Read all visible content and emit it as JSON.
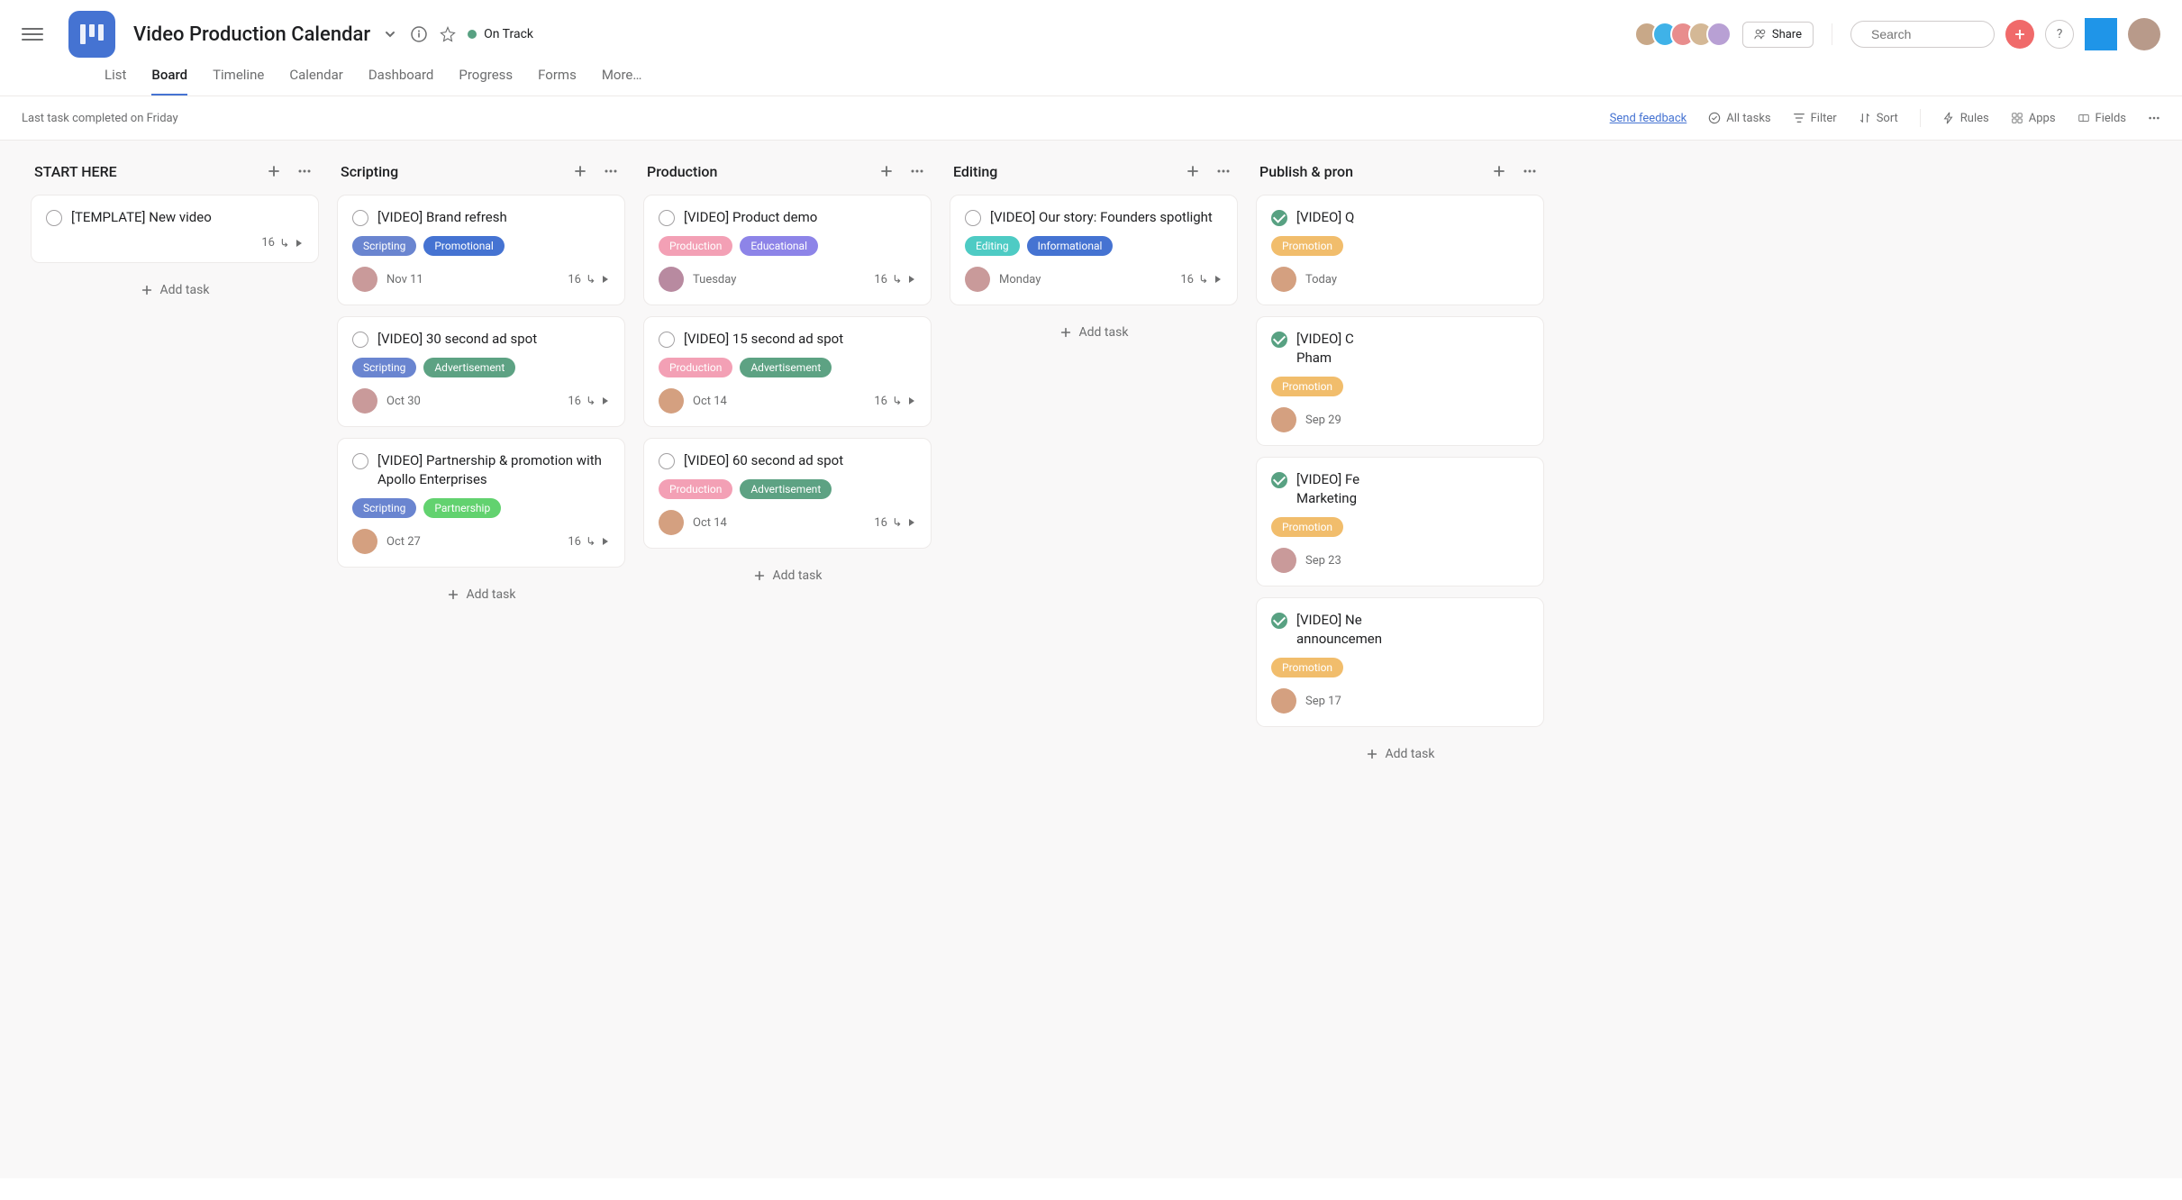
{
  "header": {
    "title": "Video Production Calendar",
    "status": "On Track",
    "tabs": [
      "List",
      "Board",
      "Timeline",
      "Calendar",
      "Dashboard",
      "Progress",
      "Forms",
      "More…"
    ],
    "active_tab": "Board",
    "share_label": "Share",
    "search_placeholder": "Search",
    "avatar_colors": [
      "#c8a888",
      "#3fb2e8",
      "#e88d8d",
      "#d4b896",
      "#b8a0d4"
    ]
  },
  "subheader": {
    "left": "Last task completed on Friday",
    "feedback": "Send feedback",
    "all_tasks": "All tasks",
    "filter": "Filter",
    "sort": "Sort",
    "rules": "Rules",
    "apps": "Apps",
    "fields": "Fields"
  },
  "add_task_label": "Add task",
  "columns": [
    {
      "title": "START HERE",
      "cards": [
        {
          "done": false,
          "title": "[TEMPLATE] New video",
          "tags": [],
          "assignee": null,
          "date": "",
          "subtasks": "16",
          "simple": true
        }
      ]
    },
    {
      "title": "Scripting",
      "cards": [
        {
          "done": false,
          "title": "[VIDEO] Brand refresh",
          "tags": [
            {
              "label": "Scripting",
              "class": "tag-scripting"
            },
            {
              "label": "Promotional",
              "class": "tag-promotional"
            }
          ],
          "assignee": "#c99a9a",
          "date": "Nov 11",
          "subtasks": "16"
        },
        {
          "done": false,
          "title": "[VIDEO] 30 second ad spot",
          "tags": [
            {
              "label": "Scripting",
              "class": "tag-scripting"
            },
            {
              "label": "Advertisement",
              "class": "tag-advertisement"
            }
          ],
          "assignee": "#c99a9a",
          "date": "Oct 30",
          "subtasks": "16"
        },
        {
          "done": false,
          "title": "[VIDEO] Partnership & promotion with Apollo Enterprises",
          "tags": [
            {
              "label": "Scripting",
              "class": "tag-scripting"
            },
            {
              "label": "Partnership",
              "class": "tag-partnership"
            }
          ],
          "assignee": "#d4a080",
          "date": "Oct 27",
          "subtasks": "16"
        }
      ]
    },
    {
      "title": "Production",
      "cards": [
        {
          "done": false,
          "title": "[VIDEO] Product demo",
          "tags": [
            {
              "label": "Production",
              "class": "tag-production"
            },
            {
              "label": "Educational",
              "class": "tag-educational"
            }
          ],
          "assignee": "#b88aa0",
          "date": "Tuesday",
          "subtasks": "16"
        },
        {
          "done": false,
          "title": "[VIDEO] 15 second ad spot",
          "tags": [
            {
              "label": "Production",
              "class": "tag-production"
            },
            {
              "label": "Advertisement",
              "class": "tag-advertisement"
            }
          ],
          "assignee": "#d4a080",
          "date": "Oct 14",
          "subtasks": "16"
        },
        {
          "done": false,
          "title": "[VIDEO] 60 second ad spot",
          "tags": [
            {
              "label": "Production",
              "class": "tag-production"
            },
            {
              "label": "Advertisement",
              "class": "tag-advertisement"
            }
          ],
          "assignee": "#d4a080",
          "date": "Oct 14",
          "subtasks": "16"
        }
      ]
    },
    {
      "title": "Editing",
      "cards": [
        {
          "done": false,
          "title": "[VIDEO] Our story: Founders spotlight",
          "tags": [
            {
              "label": "Editing",
              "class": "tag-editing"
            },
            {
              "label": "Informational",
              "class": "tag-informational"
            }
          ],
          "assignee": "#c99a9a",
          "date": "Monday",
          "subtasks": "16"
        }
      ]
    },
    {
      "title": "Publish & pron",
      "cards": [
        {
          "done": true,
          "title": "[VIDEO] Q",
          "tags": [
            {
              "label": "Promotion",
              "class": "tag-promotion"
            }
          ],
          "assignee": "#d4a080",
          "date": "Today",
          "subtasks": ""
        },
        {
          "done": true,
          "title": "[VIDEO] C",
          "title2": "Pham",
          "tags": [
            {
              "label": "Promotion",
              "class": "tag-promotion"
            }
          ],
          "assignee": "#d4a080",
          "date": "Sep 29",
          "subtasks": ""
        },
        {
          "done": true,
          "title": "[VIDEO] Fe",
          "title2": "Marketing",
          "tags": [
            {
              "label": "Promotion",
              "class": "tag-promotion"
            }
          ],
          "assignee": "#c99a9a",
          "date": "Sep 23",
          "subtasks": ""
        },
        {
          "done": true,
          "title": "[VIDEO] Ne",
          "title2": "announcemen",
          "tags": [
            {
              "label": "Promotion",
              "class": "tag-promotion"
            }
          ],
          "assignee": "#d4a080",
          "date": "Sep 17",
          "subtasks": ""
        }
      ]
    }
  ]
}
